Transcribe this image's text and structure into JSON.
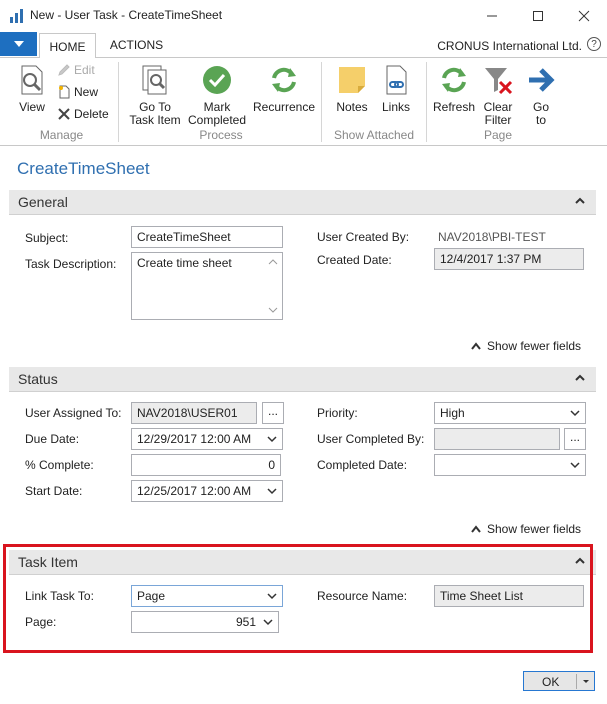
{
  "window": {
    "title": "New - User Task - CreateTimeSheet"
  },
  "ribbon": {
    "tabs": [
      {
        "label": "HOME"
      },
      {
        "label": "ACTIONS"
      }
    ],
    "company": "CRONUS International Ltd.",
    "help": "?",
    "groups": {
      "manage": {
        "label": "Manage",
        "view": "View",
        "edit": "Edit",
        "new": "New",
        "delete": "Delete"
      },
      "process": {
        "label": "Process",
        "go_to_task_item": "Go To\nTask Item",
        "go_to_task_item_l1": "Go To",
        "go_to_task_item_l2": "Task Item",
        "mark_completed_l1": "Mark",
        "mark_completed_l2": "Completed",
        "recurrence": "Recurrence"
      },
      "show_attached": {
        "label": "Show Attached",
        "notes": "Notes",
        "links": "Links"
      },
      "page": {
        "label": "Page",
        "refresh": "Refresh",
        "clear_filter_l1": "Clear",
        "clear_filter_l2": "Filter",
        "go_to_l1": "Go",
        "go_to_l2": "to"
      }
    }
  },
  "page_title": "CreateTimeSheet",
  "general": {
    "header": "General",
    "subject_label": "Subject:",
    "subject_value": "CreateTimeSheet",
    "task_description_label": "Task Description:",
    "task_description_value": "Create time sheet",
    "user_created_by_label": "User Created By:",
    "user_created_by_value": "NAV2018\\PBI-TEST",
    "created_date_label": "Created Date:",
    "created_date_value": "12/4/2017 1:37 PM",
    "show_fewer": "Show fewer fields"
  },
  "status": {
    "header": "Status",
    "user_assigned_to_label": "User Assigned To:",
    "user_assigned_to_value": "NAV2018\\USER01",
    "due_date_label": "Due Date:",
    "due_date_value": "12/29/2017 12:00 AM",
    "percent_complete_label": "% Complete:",
    "percent_complete_value": "0",
    "start_date_label": "Start Date:",
    "start_date_value": "12/25/2017 12:00 AM",
    "priority_label": "Priority:",
    "priority_value": "High",
    "user_completed_by_label": "User Completed By:",
    "user_completed_by_value": "",
    "completed_date_label": "Completed Date:",
    "completed_date_value": "",
    "ellipsis": "...",
    "show_fewer": "Show fewer fields"
  },
  "task_item": {
    "header": "Task Item",
    "link_task_to_label": "Link Task To:",
    "link_task_to_value": "Page",
    "page_label": "Page:",
    "page_value": "951",
    "resource_name_label": "Resource Name:",
    "resource_name_value": "Time Sheet List"
  },
  "footer": {
    "ok_label": "OK"
  },
  "colors": {
    "accent": "#1e6fc0",
    "title_blue": "#2f6fb0",
    "highlight": "#d9141e",
    "green": "#4caf50"
  }
}
